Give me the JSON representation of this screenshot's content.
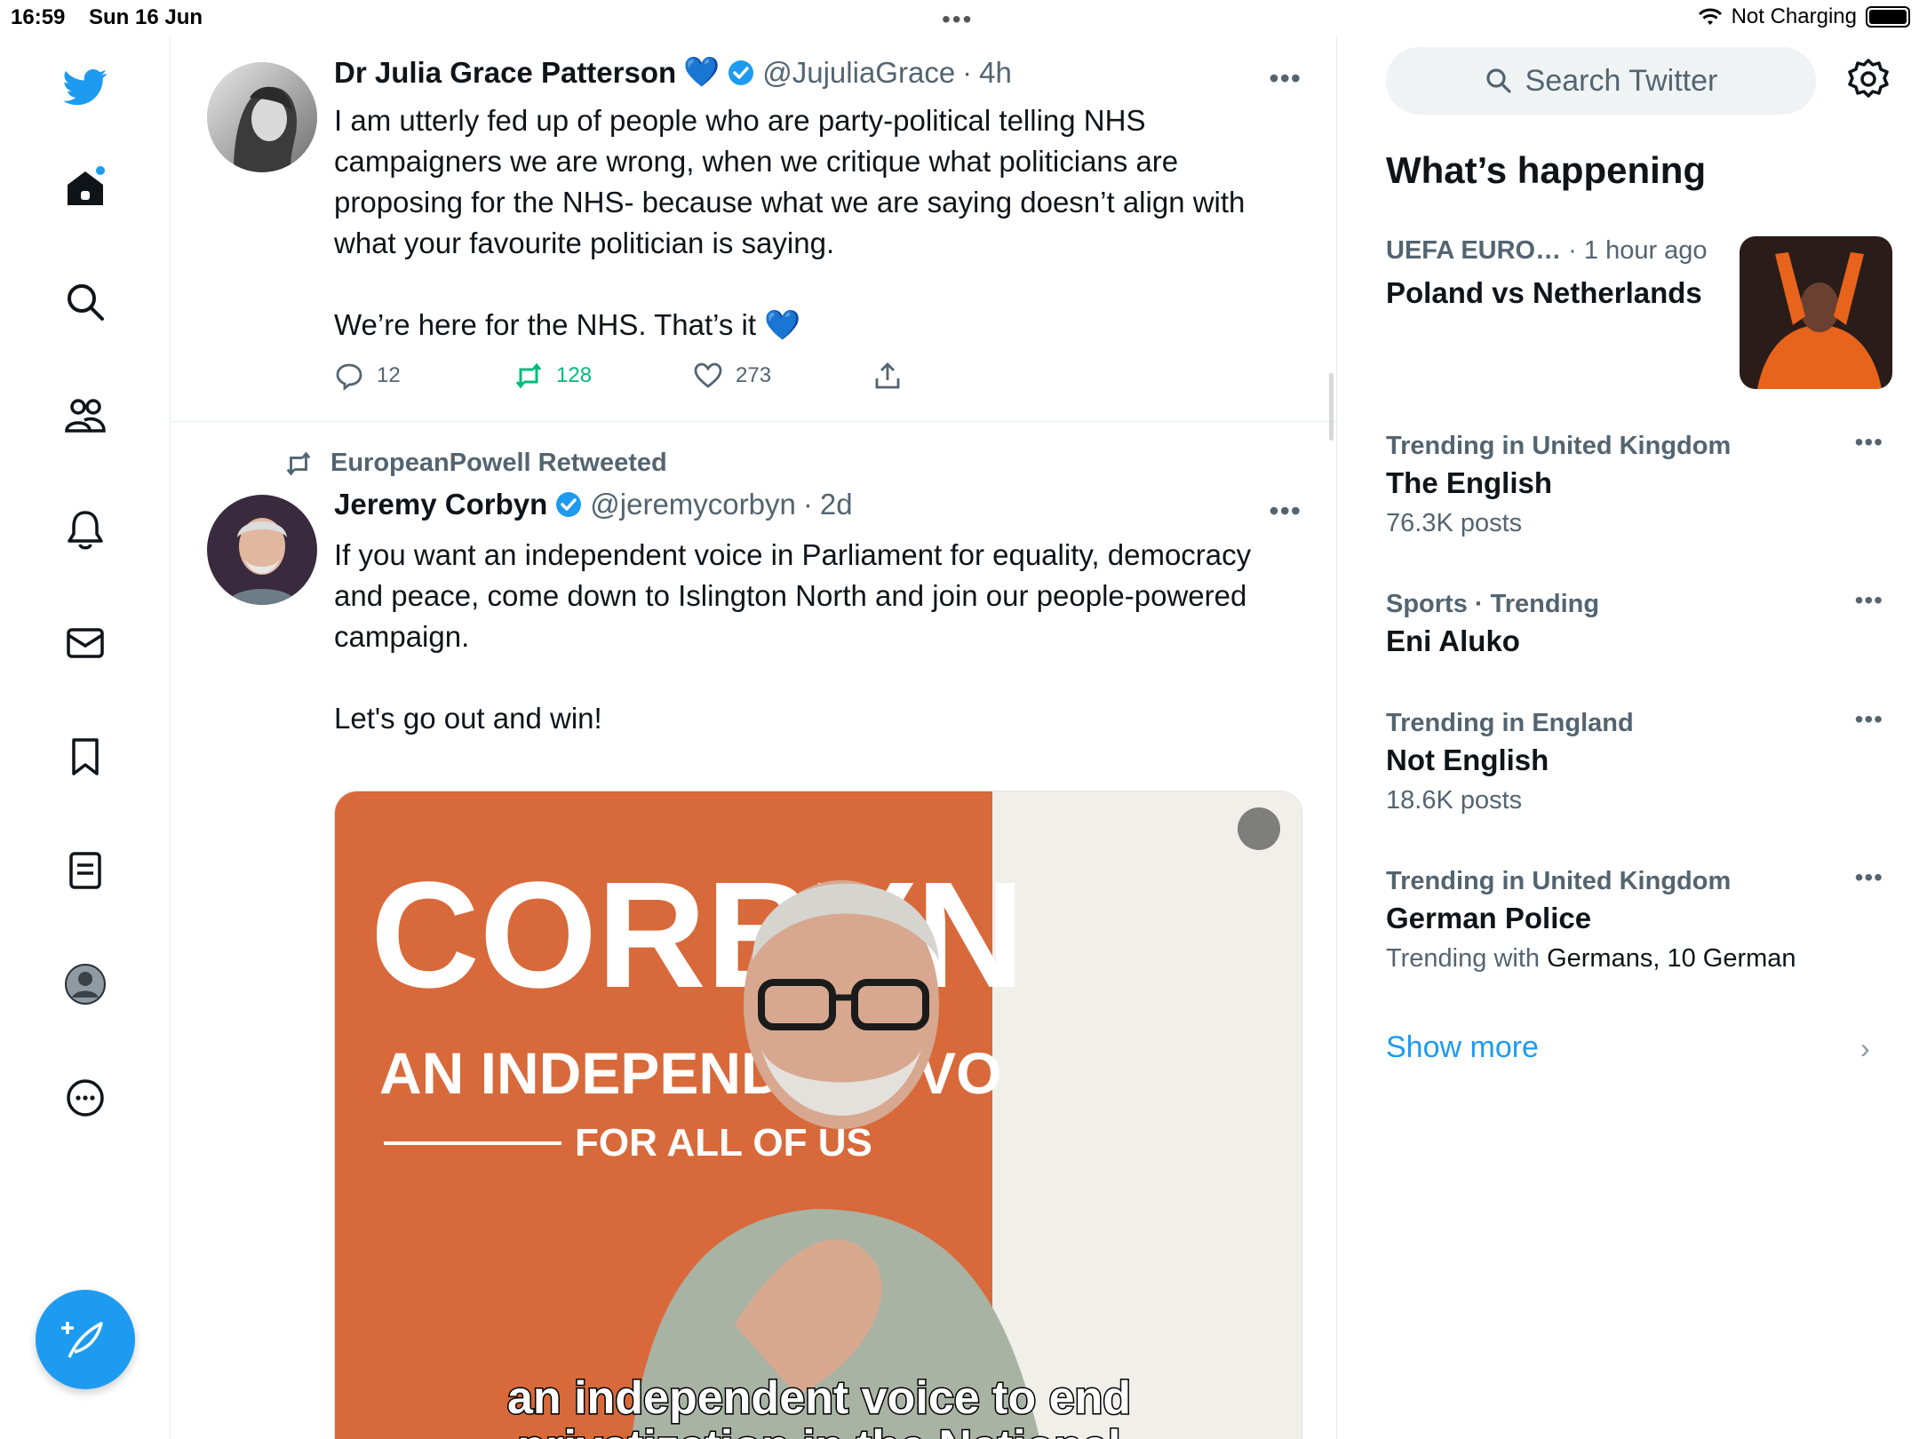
{
  "status_bar": {
    "time": "16:59",
    "date": "Sun 16 Jun",
    "multitask_dots": "•••",
    "battery_text": "Not Charging"
  },
  "nav": {
    "items": [
      "twitter-logo",
      "home",
      "explore",
      "communities",
      "notifications",
      "messages",
      "bookmarks",
      "lists",
      "profile",
      "more"
    ],
    "compose_label": "Compose"
  },
  "colors": {
    "brand": "#1d9bf0",
    "retweet": "#00ba7c",
    "secondary_text": "#536471"
  },
  "tweets": [
    {
      "name": "Dr Julia Grace Patterson",
      "name_emoji": "💙",
      "handle": "@JujuliaGrace",
      "time": "4h",
      "text": "I am utterly fed up of people who are party-political telling NHS campaigners we are wrong, when we critique what politicians are proposing for the NHS- because what we are saying doesn’t align with what your favourite politician is saying.\n\nWe’re here for the NHS. That’s it 💙",
      "replies": "12",
      "retweets": "128",
      "likes": "273",
      "more": "•••"
    },
    {
      "retweeted_by": "EuropeanPowell Retweeted",
      "name": "Jeremy Corbyn",
      "handle": "@jeremycorbyn",
      "time": "2d",
      "text": "If you want an independent voice in Parliament for equality, democracy and peace, come down to Islington North and join our people-powered campaign.\n\nLet's go out and win!",
      "more": "•••",
      "media": {
        "banner_line1": "CORBYN",
        "banner_line2": "AN INDEPENDENT VO",
        "banner_line3": "FOR ALL OF US",
        "caption_line1": "an independent voice to end",
        "caption_line2": "privatization in the National"
      }
    }
  ],
  "sidebar": {
    "search_placeholder": "Search Twitter",
    "whats_happening": "What’s happening",
    "featured": {
      "category": "UEFA EURO…",
      "time": "· 1 hour ago",
      "title": "Poland vs Netherlands"
    },
    "trends": [
      {
        "meta": "Trending in United Kingdom",
        "title": "The English",
        "count": "76.3K posts"
      },
      {
        "meta": "Sports · Trending",
        "title": "Eni Aluko",
        "count": ""
      },
      {
        "meta": "Trending in England",
        "title": "Not English",
        "count": "18.6K posts"
      },
      {
        "meta": "Trending in United Kingdom",
        "title": "German Police",
        "with_label": "Trending with",
        "with_terms": "Germans, 10 German"
      }
    ],
    "show_more": "Show more",
    "more": "•••"
  }
}
